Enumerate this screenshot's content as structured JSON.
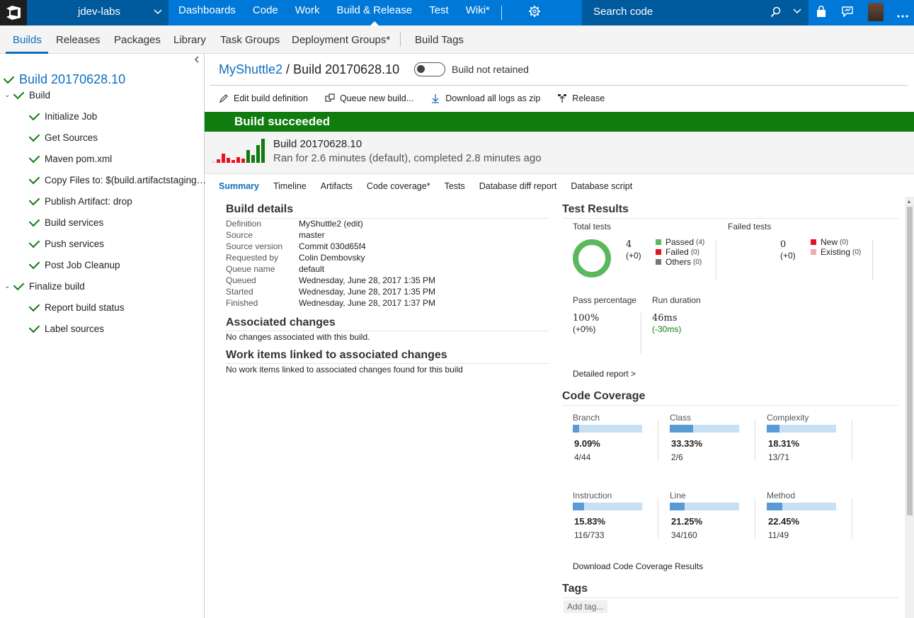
{
  "topbar": {
    "project": "jdev-labs",
    "nav": [
      "Dashboards",
      "Code",
      "Work",
      "Build & Release",
      "Test",
      "Wiki*"
    ],
    "active_nav": "Build & Release",
    "search_placeholder": "Search code",
    "icons": [
      "vsts-logo-icon",
      "chevron-down-icon",
      "gear-icon",
      "search-icon",
      "shopping-bag-icon",
      "feedback-icon",
      "avatar",
      "more-icon"
    ]
  },
  "subnav": {
    "items": [
      "Builds",
      "Releases",
      "Packages",
      "Library",
      "Task Groups",
      "Deployment Groups*",
      "Build Tags"
    ],
    "active": "Builds"
  },
  "tree": {
    "title": "Build 20170628.10",
    "phase1": "Build",
    "steps1": [
      "Initialize Job",
      "Get Sources",
      "Maven pom.xml",
      "Copy Files to: $(build.artifactstaging…",
      "Publish Artifact: drop",
      "Build services",
      "Push services",
      "Post Job Cleanup"
    ],
    "phase2": "Finalize build",
    "steps2": [
      "Report build status",
      "Label sources"
    ]
  },
  "header": {
    "project": "MyShuttle2",
    "sep": " / ",
    "build": "Build 20170628.10",
    "retained": "Build not retained"
  },
  "actions": {
    "edit": "Edit build definition",
    "queue": "Queue new build...",
    "download": "Download all logs as zip",
    "release": "Release"
  },
  "banner": "Build succeeded",
  "summary_head": {
    "title": "Build 20170628.10",
    "subtitle": "Ran for 2.6 minutes (default), completed 2.8 minutes ago",
    "history": [
      {
        "h": 2,
        "c": "#d9d9d9"
      },
      {
        "h": 5,
        "c": "#e81123"
      },
      {
        "h": 13,
        "c": "#e81123"
      },
      {
        "h": 7,
        "c": "#e81123"
      },
      {
        "h": 4,
        "c": "#e81123"
      },
      {
        "h": 8,
        "c": "#e81123"
      },
      {
        "h": 6,
        "c": "#e81123"
      },
      {
        "h": 18,
        "c": "#107c10"
      },
      {
        "h": 11,
        "c": "#107c10"
      },
      {
        "h": 25,
        "c": "#107c10"
      },
      {
        "h": 34,
        "c": "#107c10"
      }
    ]
  },
  "tabs": [
    "Summary",
    "Timeline",
    "Artifacts",
    "Code coverage*",
    "Tests",
    "Database diff report",
    "Database script"
  ],
  "build_details": {
    "heading": "Build details",
    "rows": [
      {
        "label": "Definition",
        "value": "MyShuttle2 (edit)",
        "link": true
      },
      {
        "label": "Source",
        "value": "master",
        "link": true
      },
      {
        "label": "Source version",
        "value": "Commit 030d65f4",
        "link": true
      },
      {
        "label": "Requested by",
        "value": "Colin Dembovsky",
        "link": false
      },
      {
        "label": "Queue name",
        "value": "default",
        "link": true
      },
      {
        "label": "Queued",
        "value": "Wednesday, June 28, 2017 1:35 PM",
        "link": false
      },
      {
        "label": "Started",
        "value": "Wednesday, June 28, 2017 1:35 PM",
        "link": false
      },
      {
        "label": "Finished",
        "value": "Wednesday, June 28, 2017 1:37 PM",
        "link": false
      }
    ]
  },
  "associated": {
    "heading": "Associated changes",
    "text": "No changes associated with this build."
  },
  "work_items": {
    "heading": "Work items linked to associated changes",
    "text": "No work items linked to associated changes found for this build"
  },
  "test_results": {
    "heading": "Test Results",
    "total_label": "Total tests",
    "total": "4",
    "total_delta": "(+0)",
    "legend_total": [
      {
        "label": "Passed",
        "count": "(4)",
        "color": "#5cb85c"
      },
      {
        "label": "Failed",
        "count": "(0)",
        "color": "#e81123"
      },
      {
        "label": "Others",
        "count": "(0)",
        "color": "#767676"
      }
    ],
    "failed_label": "Failed tests",
    "failed": "0",
    "failed_delta": "(+0)",
    "legend_failed": [
      {
        "label": "New",
        "count": "(0)",
        "color": "#e81123"
      },
      {
        "label": "Existing",
        "count": "(0)",
        "color": "#f4a7b0"
      }
    ],
    "pass_label": "Pass percentage",
    "pass": "100%",
    "pass_delta": "(+0%)",
    "run_label": "Run duration",
    "run": "46ms",
    "run_delta": "(-30ms)",
    "report_link": "Detailed report >"
  },
  "coverage": {
    "heading": "Code Coverage",
    "items": [
      {
        "label": "Branch",
        "pct": "9.09%",
        "frac": "4/44",
        "value": 9.09
      },
      {
        "label": "Class",
        "pct": "33.33%",
        "frac": "2/6",
        "value": 33.33
      },
      {
        "label": "Complexity",
        "pct": "18.31%",
        "frac": "13/71",
        "value": 18.31
      },
      {
        "label": "Instruction",
        "pct": "15.83%",
        "frac": "116/733",
        "value": 15.83
      },
      {
        "label": "Line",
        "pct": "21.25%",
        "frac": "34/160",
        "value": 21.25
      },
      {
        "label": "Method",
        "pct": "22.45%",
        "frac": "11/49",
        "value": 22.45
      }
    ],
    "download_link": "Download Code Coverage Results"
  },
  "tags": {
    "heading": "Tags",
    "add": "Add tag..."
  }
}
